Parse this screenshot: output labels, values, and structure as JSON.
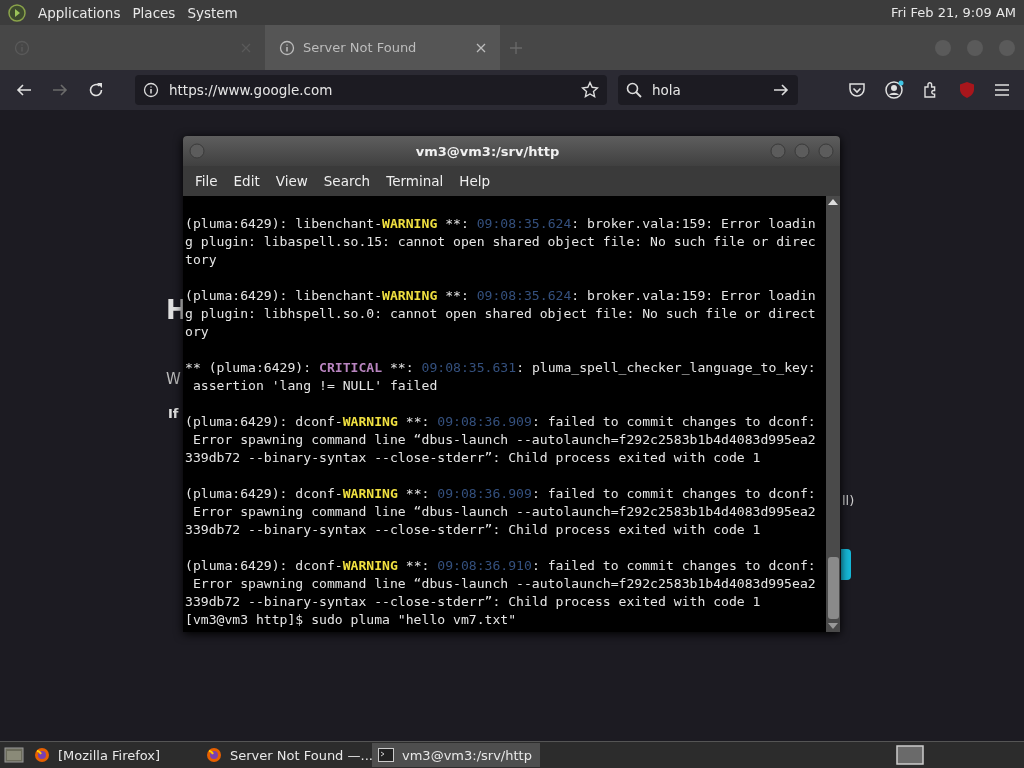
{
  "top_panel": {
    "menus": [
      "Applications",
      "Places",
      "System"
    ],
    "clock": "Fri Feb 21, 9:09 AM"
  },
  "browser": {
    "tabs": [
      {
        "selected": false
      },
      {
        "title": "Server Not Found",
        "selected": true
      }
    ],
    "nav": {
      "back_disabled": false,
      "forward_disabled": true
    },
    "url": "https://www.google.com",
    "search": "hola",
    "page": {
      "heading": "H",
      "line_1": "W",
      "line_2": "If",
      "line_3": "ll)"
    }
  },
  "terminal": {
    "title": "vm3@vm3:/srv/http",
    "menu": [
      "File",
      "Edit",
      "View",
      "Search",
      "Terminal",
      "Help"
    ],
    "entries": [
      {
        "lines": [
          [
            {
              "kind": "text",
              "text": "(pluma:6429): libenchant-"
            },
            {
              "kind": "warning",
              "text": "WARNING"
            },
            {
              "kind": "text",
              "text": " **: "
            },
            {
              "kind": "time",
              "text": "09:08:35.624"
            },
            {
              "kind": "text",
              "text": ": broker.vala:159: Error loadin"
            }
          ],
          [
            {
              "kind": "text",
              "text": "g plugin: libaspell.so.15: cannot open shared object file: No such file or direc"
            }
          ],
          [
            {
              "kind": "text",
              "text": "tory"
            }
          ]
        ]
      },
      {
        "lines": [
          [
            {
              "kind": "text",
              "text": "(pluma:6429): libenchant-"
            },
            {
              "kind": "warning",
              "text": "WARNING"
            },
            {
              "kind": "text",
              "text": " **: "
            },
            {
              "kind": "time",
              "text": "09:08:35.624"
            },
            {
              "kind": "text",
              "text": ": broker.vala:159: Error loadin"
            }
          ],
          [
            {
              "kind": "text",
              "text": "g plugin: libhspell.so.0: cannot open shared object file: No such file or direct"
            }
          ],
          [
            {
              "kind": "text",
              "text": "ory"
            }
          ]
        ]
      },
      {
        "lines": [
          [
            {
              "kind": "text",
              "text": "** (pluma:6429): "
            },
            {
              "kind": "critical",
              "text": "CRITICAL"
            },
            {
              "kind": "text",
              "text": " **: "
            },
            {
              "kind": "time",
              "text": "09:08:35.631"
            },
            {
              "kind": "text",
              "text": ": pluma_spell_checker_language_to_key:"
            }
          ],
          [
            {
              "kind": "text",
              "text": " assertion 'lang != NULL' failed"
            }
          ]
        ]
      },
      {
        "lines": [
          [
            {
              "kind": "text",
              "text": "(pluma:6429): dconf-"
            },
            {
              "kind": "warning",
              "text": "WARNING"
            },
            {
              "kind": "text",
              "text": " **: "
            },
            {
              "kind": "time",
              "text": "09:08:36.909"
            },
            {
              "kind": "text",
              "text": ": failed to commit changes to dconf:"
            }
          ],
          [
            {
              "kind": "text",
              "text": " Error spawning command line “dbus-launch --autolaunch=f292c2583b1b4d4083d995ea2"
            }
          ],
          [
            {
              "kind": "text",
              "text": "339db72 --binary-syntax --close-stderr”: Child process exited with code 1"
            }
          ]
        ]
      },
      {
        "lines": [
          [
            {
              "kind": "text",
              "text": "(pluma:6429): dconf-"
            },
            {
              "kind": "warning",
              "text": "WARNING"
            },
            {
              "kind": "text",
              "text": " **: "
            },
            {
              "kind": "time",
              "text": "09:08:36.909"
            },
            {
              "kind": "text",
              "text": ": failed to commit changes to dconf:"
            }
          ],
          [
            {
              "kind": "text",
              "text": " Error spawning command line “dbus-launch --autolaunch=f292c2583b1b4d4083d995ea2"
            }
          ],
          [
            {
              "kind": "text",
              "text": "339db72 --binary-syntax --close-stderr”: Child process exited with code 1"
            }
          ]
        ]
      },
      {
        "lines": [
          [
            {
              "kind": "text",
              "text": "(pluma:6429): dconf-"
            },
            {
              "kind": "warning",
              "text": "WARNING"
            },
            {
              "kind": "text",
              "text": " **: "
            },
            {
              "kind": "time",
              "text": "09:08:36.910"
            },
            {
              "kind": "text",
              "text": ": failed to commit changes to dconf:"
            }
          ],
          [
            {
              "kind": "text",
              "text": " Error spawning command line “dbus-launch --autolaunch=f292c2583b1b4d4083d995ea2"
            }
          ],
          [
            {
              "kind": "text",
              "text": "339db72 --binary-syntax --close-stderr”: Child process exited with code 1"
            }
          ]
        ]
      }
    ],
    "prompt": "[vm3@vm3 http]$ sudo pluma \"hello vm7.txt\""
  },
  "taskbar": {
    "items": [
      {
        "kind": "firefox",
        "label": "[Mozilla Firefox]",
        "selected": false
      },
      {
        "kind": "firefox",
        "label": "Server Not Found —...",
        "selected": false
      },
      {
        "kind": "terminal",
        "label": "vm3@vm3:/srv/http",
        "selected": true
      }
    ]
  }
}
